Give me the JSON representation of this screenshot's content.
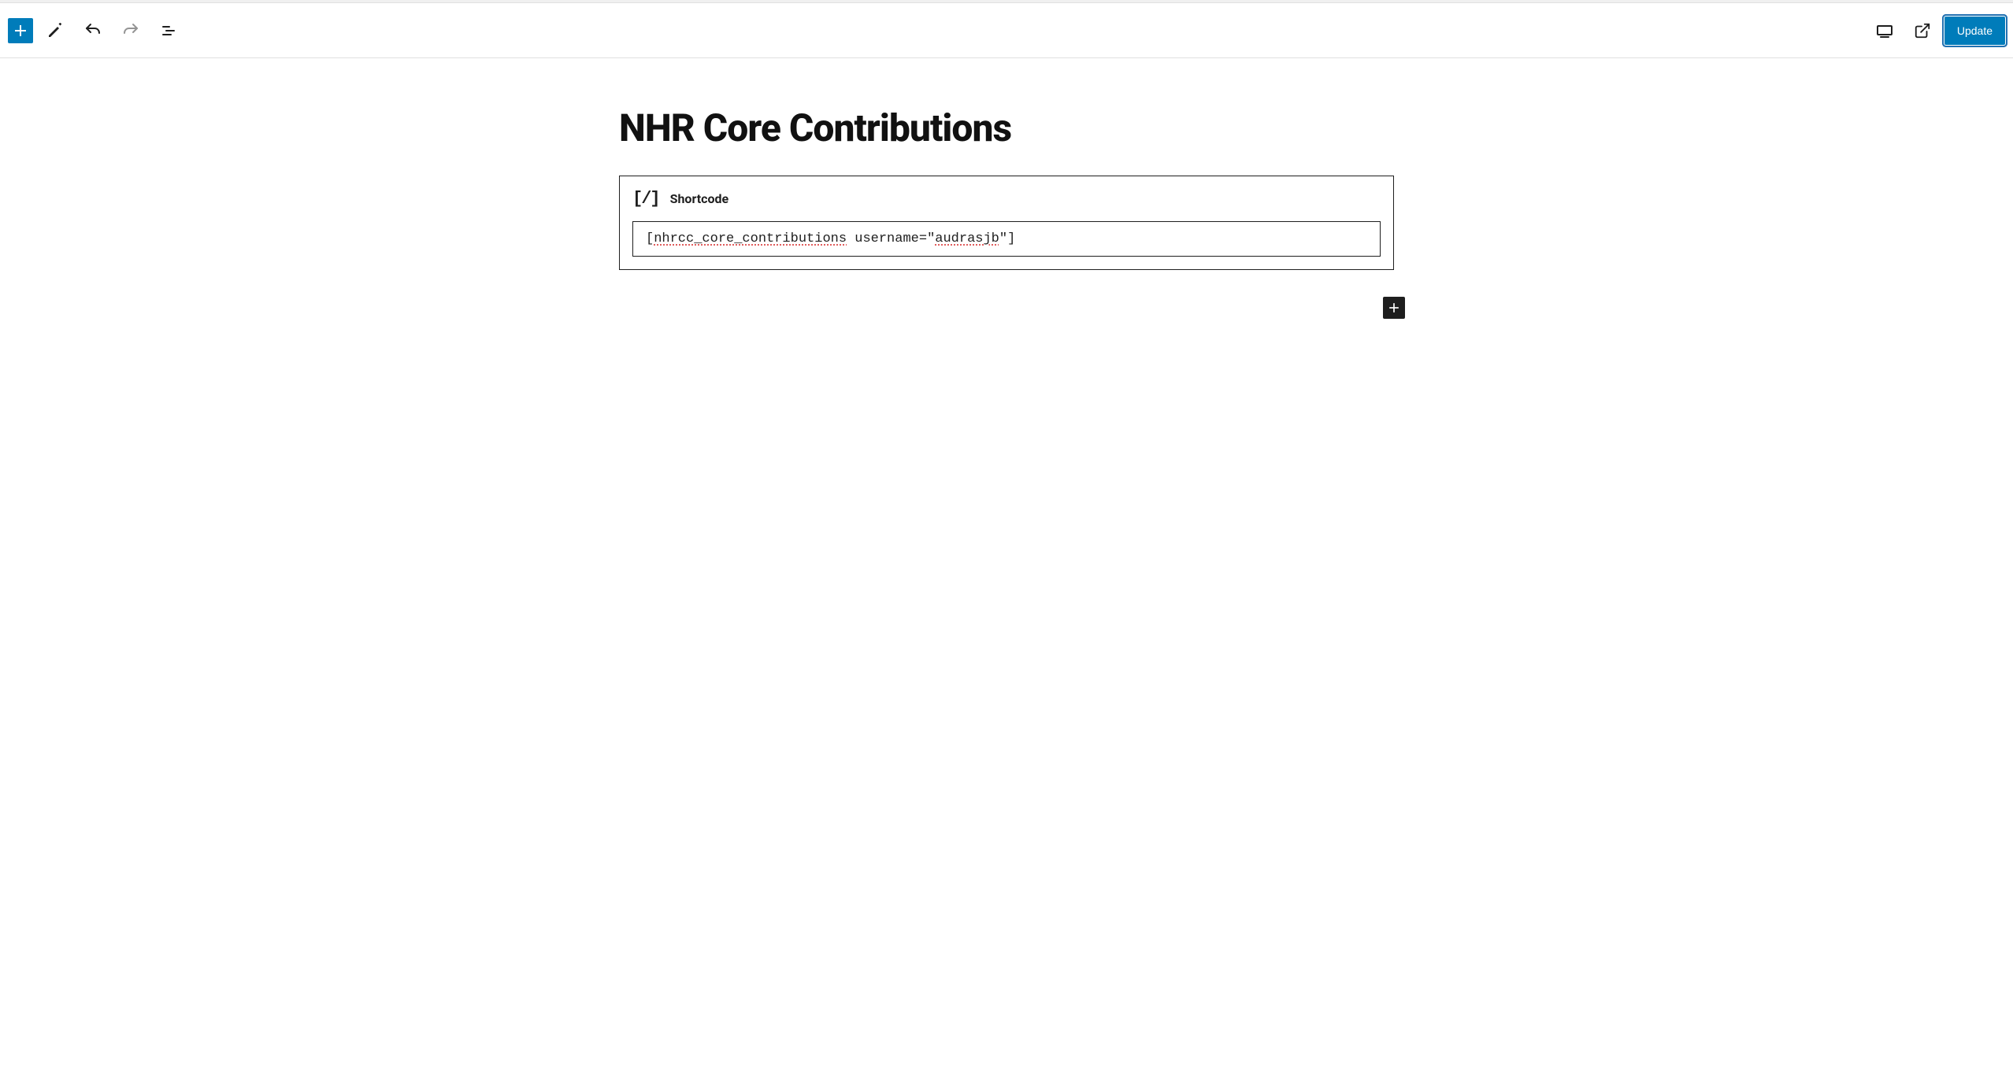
{
  "toolbar": {
    "update_label": "Update"
  },
  "page": {
    "title": "NHR Core Contributions"
  },
  "block": {
    "label": "Shortcode",
    "content_prefix": "[",
    "content_name": "nhrcc_core_contributions",
    "content_mid": " username=\"",
    "content_user": "audrasjb",
    "content_suffix": "\"]"
  }
}
